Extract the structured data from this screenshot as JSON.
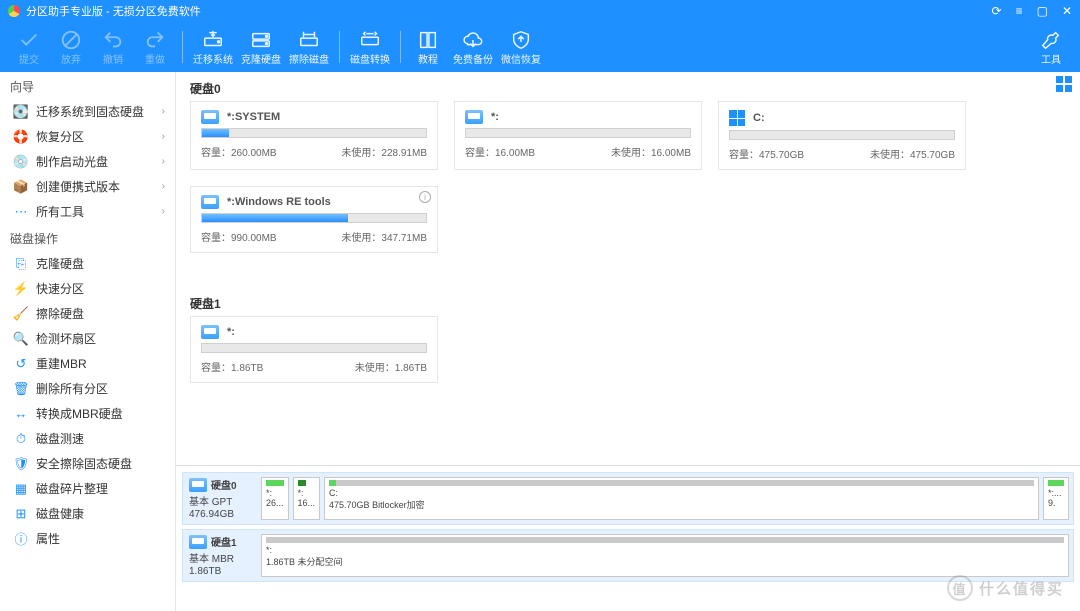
{
  "title": {
    "app": "分区助手专业版",
    "suffix": "无损分区免费软件"
  },
  "toolbar": {
    "commit": "提交",
    "undo": "放弃",
    "revoke": "撤销",
    "redo": "重做",
    "migrate": "迁移系统",
    "clone": "克隆硬盘",
    "wipe": "擦除磁盘",
    "convert": "磁盘转换",
    "tutorial": "教程",
    "backup": "免费备份",
    "wxrestore": "微信恢复",
    "tools": "工具"
  },
  "sidebar": {
    "wizards_title": "向导",
    "wizards": [
      {
        "icon": "💽",
        "label": "迁移系统到固态硬盘"
      },
      {
        "icon": "🛟",
        "label": "恢复分区"
      },
      {
        "icon": "💿",
        "label": "制作启动光盘"
      },
      {
        "icon": "📦",
        "label": "创建便携式版本"
      },
      {
        "icon": "⋯",
        "label": "所有工具"
      }
    ],
    "ops_title": "磁盘操作",
    "ops": [
      {
        "icon": "⎘",
        "label": "克隆硬盘"
      },
      {
        "icon": "⚡",
        "label": "快速分区"
      },
      {
        "icon": "🧹",
        "label": "擦除硬盘"
      },
      {
        "icon": "🔍",
        "label": "检测坏扇区"
      },
      {
        "icon": "↺",
        "label": "重建MBR"
      },
      {
        "icon": "🗑",
        "label": "删除所有分区"
      },
      {
        "icon": "↔",
        "label": "转换成MBR硬盘"
      },
      {
        "icon": "⏱",
        "label": "磁盘测速"
      },
      {
        "icon": "🛡",
        "label": "安全擦除固态硬盘"
      },
      {
        "icon": "▦",
        "label": "磁盘碎片整理"
      },
      {
        "icon": "⊞",
        "label": "磁盘健康"
      },
      {
        "icon": "ⓘ",
        "label": "属性"
      }
    ]
  },
  "disks": [
    {
      "title": "硬盘0",
      "partitions": [
        {
          "name": "*:SYSTEM",
          "capacity_label": "容量：",
          "capacity": "260.00MB",
          "unused_label": "未使用：",
          "unused": "228.91MB",
          "fill_pct": 12,
          "icon": "disk"
        },
        {
          "name": "*:",
          "capacity_label": "容量：",
          "capacity": "16.00MB",
          "unused_label": "未使用：",
          "unused": "16.00MB",
          "fill_pct": 0,
          "icon": "disk"
        },
        {
          "name": "C:",
          "capacity_label": "容量：",
          "capacity": "475.70GB",
          "unused_label": "未使用：",
          "unused": "475.70GB",
          "fill_pct": 0,
          "icon": "win"
        },
        {
          "name": "*:Windows RE tools",
          "capacity_label": "容量：",
          "capacity": "990.00MB",
          "unused_label": "未使用：",
          "unused": "347.71MB",
          "fill_pct": 65,
          "icon": "disk",
          "info": true
        }
      ]
    },
    {
      "title": "硬盘1",
      "partitions": [
        {
          "name": "*:",
          "capacity_label": "容量：",
          "capacity": "1.86TB",
          "unused_label": "未使用：",
          "unused": "1.86TB",
          "fill_pct": 0,
          "icon": "disk"
        }
      ]
    }
  ],
  "diskrows": [
    {
      "name": "硬盘0",
      "type": "基本 GPT",
      "size": "476.94GB",
      "segments": [
        {
          "label1": "*:",
          "label2": "26...",
          "stripe": "green",
          "flex": false
        },
        {
          "label1": "*:",
          "label2": "16...",
          "stripe": "dgreen",
          "flex": false
        },
        {
          "label1": "C:",
          "label2": "475.70GB Bitlocker加密",
          "stripe": "ggrad",
          "flex": true
        },
        {
          "label1": "*:...",
          "label2": "9.",
          "stripe": "green",
          "flex": false
        }
      ]
    },
    {
      "name": "硬盘1",
      "type": "基本 MBR",
      "size": "1.86TB",
      "segments": [
        {
          "label1": "*:",
          "label2": "1.86TB 未分配空间",
          "stripe": "grey",
          "flex": true
        }
      ]
    }
  ],
  "watermark": {
    "badge": "值",
    "text": "什么值得买"
  }
}
